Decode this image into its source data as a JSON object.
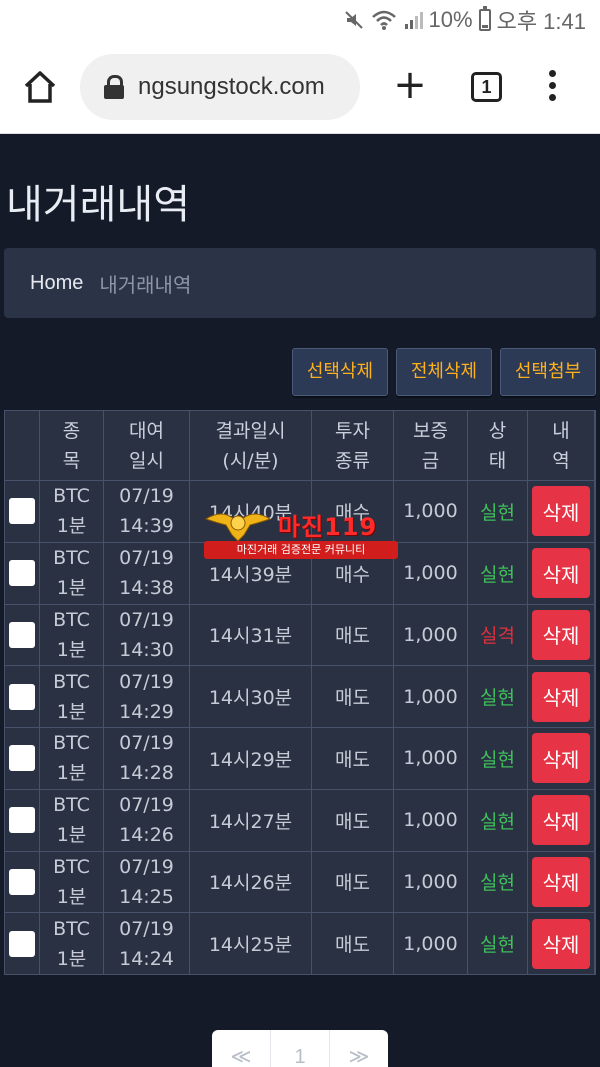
{
  "status_bar": {
    "battery": "10%",
    "time": "오후 1:41"
  },
  "browser": {
    "url": "ngsungstock.com",
    "tab_count": "1"
  },
  "page": {
    "title": "내거래내역",
    "breadcrumb": {
      "home": "Home",
      "current": "내거래내역"
    }
  },
  "actions": {
    "delete_selected": "선택삭제",
    "delete_all": "전체삭제",
    "attach_selected": "선택첨부"
  },
  "table": {
    "headers": [
      {
        "line1": "종",
        "line2": "목"
      },
      {
        "line1": "대여",
        "line2": "일시"
      },
      {
        "line1": "결과일시",
        "line2": "(시/분)"
      },
      {
        "line1": "투자",
        "line2": "종류"
      },
      {
        "line1": "보증",
        "line2": "금"
      },
      {
        "line1": "상",
        "line2": "태"
      },
      {
        "line1": "내",
        "line2": "역"
      }
    ],
    "rows": [
      {
        "symbol": "BTC",
        "period": "1분",
        "date": "07/19",
        "time": "14:39",
        "result": "14시40분",
        "type": "매수",
        "amount": "1,000",
        "status": "실현",
        "action": "삭제"
      },
      {
        "symbol": "BTC",
        "period": "1분",
        "date": "07/19",
        "time": "14:38",
        "result": "14시39분",
        "type": "매수",
        "amount": "1,000",
        "status": "실현",
        "action": "삭제"
      },
      {
        "symbol": "BTC",
        "period": "1분",
        "date": "07/19",
        "time": "14:30",
        "result": "14시31분",
        "type": "매도",
        "amount": "1,000",
        "status": "실격",
        "action": "삭제"
      },
      {
        "symbol": "BTC",
        "period": "1분",
        "date": "07/19",
        "time": "14:29",
        "result": "14시30분",
        "type": "매도",
        "amount": "1,000",
        "status": "실현",
        "action": "삭제"
      },
      {
        "symbol": "BTC",
        "period": "1분",
        "date": "07/19",
        "time": "14:28",
        "result": "14시29분",
        "type": "매도",
        "amount": "1,000",
        "status": "실현",
        "action": "삭제"
      },
      {
        "symbol": "BTC",
        "period": "1분",
        "date": "07/19",
        "time": "14:26",
        "result": "14시27분",
        "type": "매도",
        "amount": "1,000",
        "status": "실현",
        "action": "삭제"
      },
      {
        "symbol": "BTC",
        "period": "1분",
        "date": "07/19",
        "time": "14:25",
        "result": "14시26분",
        "type": "매도",
        "amount": "1,000",
        "status": "실현",
        "action": "삭제"
      },
      {
        "symbol": "BTC",
        "period": "1분",
        "date": "07/19",
        "time": "14:24",
        "result": "14시25분",
        "type": "매도",
        "amount": "1,000",
        "status": "실현",
        "action": "삭제"
      }
    ]
  },
  "watermark": {
    "name": "마진119",
    "tagline": "마진거래 검증전문 커뮤니티"
  },
  "pagination": {
    "prev": "≪",
    "page": "1",
    "next": "≫"
  },
  "colors": {
    "background": "#141a27",
    "accent": "#ffb11a",
    "delete": "#e63446",
    "success": "#3fbf5b",
    "fail": "#e0303c"
  }
}
